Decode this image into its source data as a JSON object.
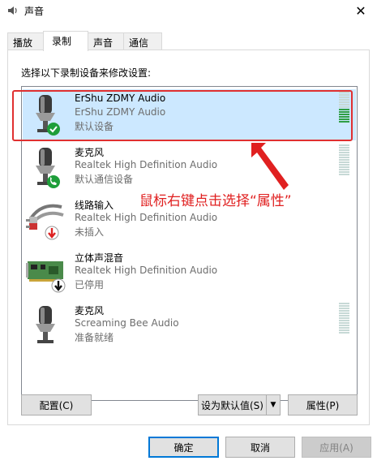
{
  "window": {
    "title": "声音",
    "close_label": "✕"
  },
  "tabs": [
    {
      "label": "播放"
    },
    {
      "label": "录制"
    },
    {
      "label": "声音"
    },
    {
      "label": "通信"
    }
  ],
  "instruction": "选择以下录制设备来修改设置:",
  "devices": [
    {
      "name": "ErShu ZDMY Audio",
      "driver": "ErShu ZDMY Audio",
      "status": "默认设备",
      "icon": "microphone-icon",
      "badge": "check-badge",
      "level": 0.4
    },
    {
      "name": "麦克风",
      "driver": "Realtek High Definition Audio",
      "status": "默认通信设备",
      "icon": "microphone-icon",
      "badge": "phone-badge",
      "level": 0
    },
    {
      "name": "线路输入",
      "driver": "Realtek High Definition Audio",
      "status": "未插入",
      "icon": "line-in-jack-icon",
      "badge": "red-down-arrow-badge"
    },
    {
      "name": "立体声混音",
      "driver": "Realtek High Definition Audio",
      "status": "已停用",
      "icon": "sound-card-icon",
      "badge": "black-down-arrow-badge"
    },
    {
      "name": "麦克风",
      "driver": "Screaming Bee Audio",
      "status": "准备就绪",
      "icon": "microphone-icon",
      "level": 0
    }
  ],
  "annotation": "鼠标右键点击选择“属性”",
  "buttons": {
    "configure": "配置(C)",
    "set_default": "设为默认值(S)",
    "properties": "属性(P)",
    "ok": "确定",
    "cancel": "取消",
    "apply": "应用(A)"
  },
  "colors": {
    "selection": "#cce8ff",
    "annotation_red": "#e02020",
    "level_green": "#2f9e45",
    "default_button_border": "#0078d7"
  }
}
